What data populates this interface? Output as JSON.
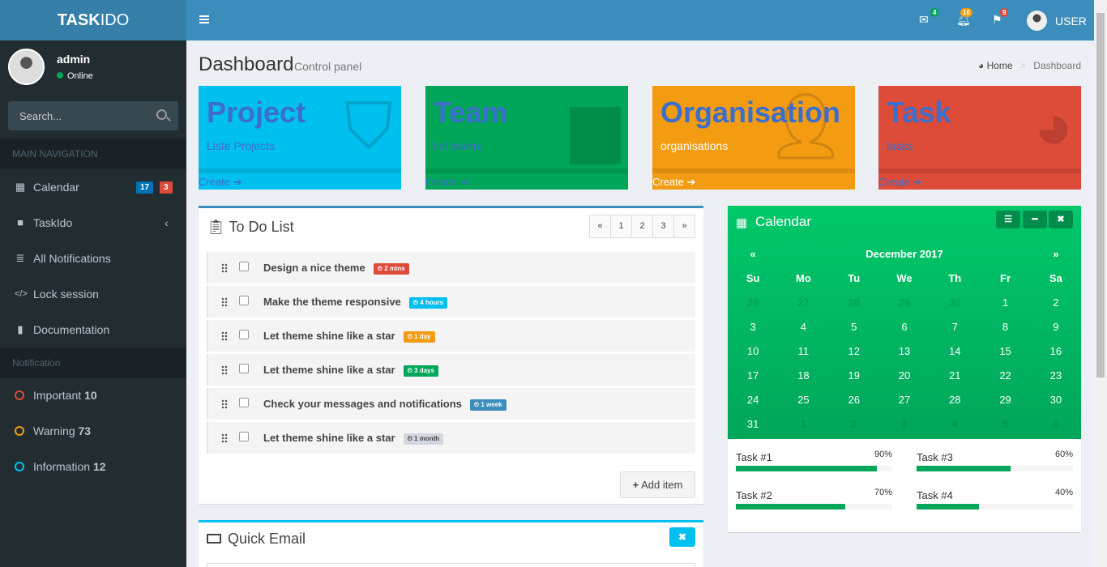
{
  "app": {
    "logo_bold": "TASK",
    "logo_light": "IDO"
  },
  "user": {
    "name": "admin",
    "status": "Online"
  },
  "search": {
    "placeholder": "Search..."
  },
  "sidebar": {
    "main_header": "MAIN NAVIGATION",
    "items": [
      {
        "label": "Calendar",
        "icon": "calendar-icon",
        "badges": [
          "17",
          "3"
        ]
      },
      {
        "label": "TaskIdo",
        "icon": "folder-icon"
      },
      {
        "label": "All Notifications",
        "icon": "list-icon"
      },
      {
        "label": "Lock session",
        "icon": "code-icon"
      },
      {
        "label": "Documentation",
        "icon": "book-icon"
      }
    ],
    "notif_header": "Notification",
    "notifications": [
      {
        "label": "Important",
        "count": "10",
        "color": "#dd4b39"
      },
      {
        "label": "Warning",
        "count": "73",
        "color": "#f39c12"
      },
      {
        "label": "Information",
        "count": "12",
        "color": "#00c0ef"
      }
    ]
  },
  "topbar": {
    "mail_count": "4",
    "bell_count": "10",
    "flag_count": "9",
    "user": "USER"
  },
  "page": {
    "title": "Dashboard",
    "subtitle": "Control panel",
    "crumb_home": "Home",
    "crumb_current": "Dashboard"
  },
  "boxes": [
    {
      "title": "Project",
      "subtitle": "Liste Projects",
      "footer": "Create",
      "color": "#00c0ef",
      "icon": "shopping-bag-icon"
    },
    {
      "title": "Team",
      "subtitle": "list teams",
      "footer": "Create",
      "color": "#00a65a",
      "icon": "bar-chart-icon"
    },
    {
      "title": "Organisation",
      "subtitle": "organisations",
      "footer": "Create",
      "color": "#f39c12",
      "icon": "user-plus-icon"
    },
    {
      "title": "Task",
      "subtitle": "tasks",
      "footer": "Create",
      "color": "#dd4b39",
      "icon": "pie-chart-icon"
    }
  ],
  "todo": {
    "title": "To Do List",
    "pages": [
      "«",
      "1",
      "2",
      "3",
      "»"
    ],
    "items": [
      {
        "text": "Design a nice theme",
        "label": "2 mins",
        "color": "#dd4b39"
      },
      {
        "text": "Make the theme responsive",
        "label": "4 hours",
        "color": "#00c0ef"
      },
      {
        "text": "Let theme shine like a star",
        "label": "1 day",
        "color": "#f39c12"
      },
      {
        "text": "Let theme shine like a star",
        "label": "3 days",
        "color": "#00a65a"
      },
      {
        "text": "Check your messages and notifications",
        "label": "1 week",
        "color": "#3c8dbc"
      },
      {
        "text": "Let theme shine like a star",
        "label": "1 month",
        "color": "#d2d6de"
      }
    ],
    "add_label": "Add item"
  },
  "quick_email": {
    "title": "Quick Email"
  },
  "calendar": {
    "title": "Calendar",
    "month": "December 2017",
    "prev": "«",
    "next": "»",
    "weekdays": [
      "Su",
      "Mo",
      "Tu",
      "We",
      "Th",
      "Fr",
      "Sa"
    ],
    "weeks": [
      [
        "26",
        "27",
        "28",
        "29",
        "30",
        "1",
        "2"
      ],
      [
        "3",
        "4",
        "5",
        "6",
        "7",
        "8",
        "9"
      ],
      [
        "10",
        "11",
        "12",
        "13",
        "14",
        "15",
        "16"
      ],
      [
        "17",
        "18",
        "19",
        "20",
        "21",
        "22",
        "23"
      ],
      [
        "24",
        "25",
        "26",
        "27",
        "28",
        "29",
        "30"
      ],
      [
        "31",
        "1",
        "2",
        "3",
        "4",
        "5",
        "6"
      ]
    ],
    "tasks": [
      {
        "label": "Task #1",
        "percent": "90%",
        "fill": 0.9
      },
      {
        "label": "Task #3",
        "percent": "60%",
        "fill": 0.6
      },
      {
        "label": "Task #2",
        "percent": "70%",
        "fill": 0.7
      },
      {
        "label": "Task #4",
        "percent": "40%",
        "fill": 0.4
      }
    ]
  }
}
